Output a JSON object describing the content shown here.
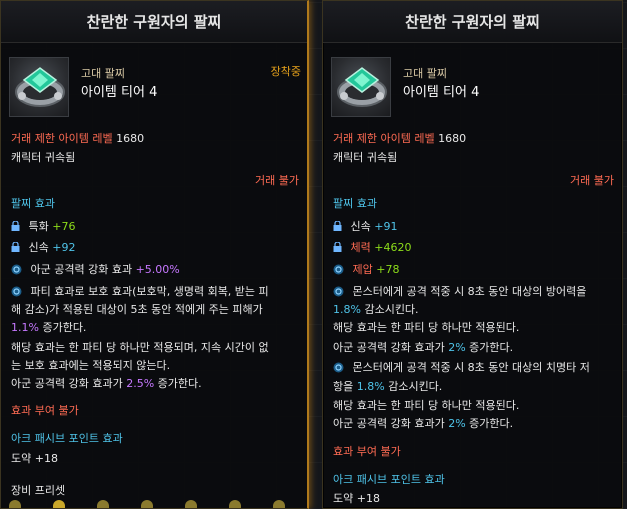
{
  "left": {
    "title": "찬란한 구원자의 팔찌",
    "grade": "고대 팔찌",
    "tier": "아이템 티어 4",
    "equipped": "장착중",
    "trade_level_label": "거래 제한 아이템 레벨",
    "trade_level_value": "1680",
    "bound": "캐릭터 귀속됨",
    "untradeable": "거래 불가",
    "section_label": "팔찌 효과",
    "stats": [
      {
        "name": "특화",
        "value": "+76"
      },
      {
        "name": "신속",
        "value": "+92"
      }
    ],
    "ally_effect_label": "아군 공격력 강화 효과",
    "ally_effect_value": "+5.00%",
    "desc": [
      "파티 효과로 보호 효과(보호막, 생명력 회복, 받는 피",
      "해 감소)가 적용된 대상이 5초 동안 적에게 주는 피해가",
      "1.1%",
      "증가한다.",
      "해당 효과는 한 파티 당 하나만 적용되며, 지속 시간이 없",
      "는 보호 효과에는 적용되지 않는다.",
      "아군 공격력 강화 효과가",
      "2.5%",
      "증가한다."
    ],
    "effect_grant": "효과 부여 불가",
    "ark_label": "아크 패시브 포인트 효과",
    "ark_value": "도약 +18",
    "preset": "장비 프리셋"
  },
  "right": {
    "title": "찬란한 구원자의 팔찌",
    "grade": "고대 팔찌",
    "tier": "아이템 티어 4",
    "trade_level_label": "거래 제한 아이템 레벨",
    "trade_level_value": "1680",
    "bound": "캐릭터 귀속됨",
    "untradeable": "거래 불가",
    "section_label": "팔찌 효과",
    "stats": [
      {
        "name": "신속",
        "value": "+91"
      },
      {
        "name": "체력",
        "value": "+4620"
      },
      {
        "name": "제압",
        "value": "+78"
      }
    ],
    "desc1": [
      "몬스터에게 공격 적중 시 8초 동안 대상의 방어력을",
      "1.8%",
      "감소시킨다.",
      "해당 효과는 한 파티 당 하나만 적용된다.",
      "아군 공격력 강화 효과가",
      "2%",
      "증가한다."
    ],
    "desc2": [
      "몬스터에게 공격 적중 시 8초 동안 대상의 치명타 저",
      "항을",
      "1.8%",
      "감소시킨다.",
      "해당 효과는 한 파티 당 하나만 적용된다.",
      "아군 공격력 강화 효과가",
      "2%",
      "증가한다."
    ],
    "effect_grant": "효과 부여 불가",
    "ark_label": "아크 패시브 포인트 효과",
    "ark_value": "도약 +18"
  },
  "colors": {
    "red": "#ff6b53",
    "green": "#8ddc1a",
    "cyan": "#4fc3e8",
    "purple": "#c678ff",
    "gold": "#e7a21b"
  }
}
